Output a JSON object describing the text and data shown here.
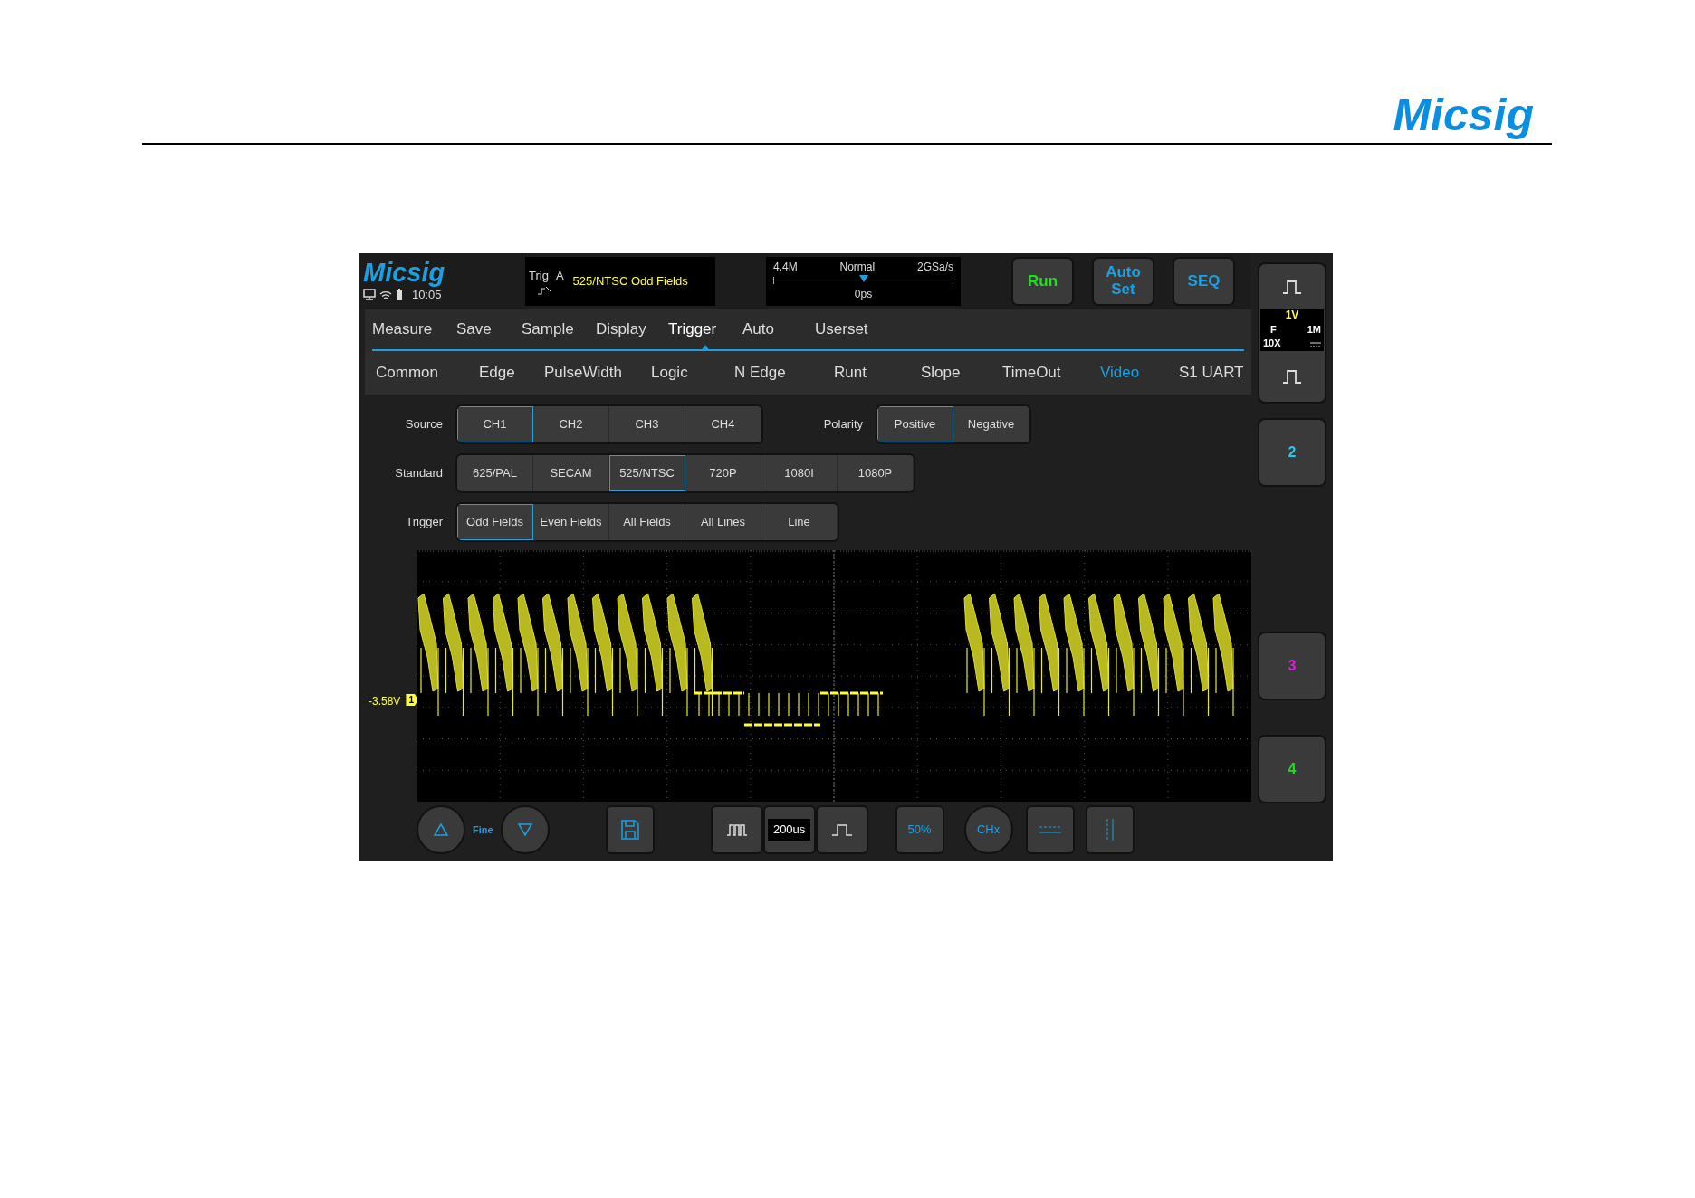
{
  "header": {
    "logo": "Micsig"
  },
  "screen": {
    "status": {
      "logo": "Micsig",
      "time": "10:05"
    },
    "trigger_info": {
      "label": "Trig",
      "source": "A",
      "description": "525/NTSC Odd Fields"
    },
    "acquisition": {
      "memory": "4.4M",
      "mode": "Normal",
      "sample_rate": "2GSa/s",
      "position": "0ps",
      "level": 0.5
    },
    "buttons": [
      {
        "label": "Run",
        "kind": "run"
      },
      {
        "label": "Auto Set",
        "kind": "mode"
      },
      {
        "label": "SEQ",
        "kind": "mode"
      }
    ],
    "menu_tabs": [
      {
        "label": "Measure",
        "selected": false
      },
      {
        "label": "Save",
        "selected": false
      },
      {
        "label": "Sample",
        "selected": false
      },
      {
        "label": "Display",
        "selected": false
      },
      {
        "label": "Trigger",
        "selected": true
      },
      {
        "label": "Auto",
        "selected": false
      },
      {
        "label": "Userset",
        "selected": false
      }
    ],
    "trigger_types": [
      {
        "label": "Common",
        "selected": false
      },
      {
        "label": "Edge",
        "selected": false
      },
      {
        "label": "PulseWidth",
        "selected": false
      },
      {
        "label": "Logic",
        "selected": false
      },
      {
        "label": "N Edge",
        "selected": false
      },
      {
        "label": "Runt",
        "selected": false
      },
      {
        "label": "Slope",
        "selected": false
      },
      {
        "label": "TimeOut",
        "selected": false
      },
      {
        "label": "Video",
        "selected": true
      },
      {
        "label": "S1 UART",
        "selected": false
      }
    ],
    "settings": [
      {
        "label": "Source",
        "options": [
          {
            "label": "CH1",
            "selected": true
          },
          {
            "label": "CH2",
            "selected": false
          },
          {
            "label": "CH3",
            "selected": false
          },
          {
            "label": "CH4",
            "selected": false
          }
        ]
      },
      {
        "label": "Standard",
        "options": [
          {
            "label": "625/PAL",
            "selected": false
          },
          {
            "label": "SECAM",
            "selected": false
          },
          {
            "label": "525/NTSC",
            "selected": true
          },
          {
            "label": "720P",
            "selected": false
          },
          {
            "label": "1080I",
            "selected": false
          },
          {
            "label": "1080P",
            "selected": false
          }
        ]
      },
      {
        "label": "Trigger",
        "options": [
          {
            "label": "Odd Fields",
            "selected": true
          },
          {
            "label": "Even Fields",
            "selected": false
          },
          {
            "label": "All Fields",
            "selected": false
          },
          {
            "label": "All Lines",
            "selected": false
          },
          {
            "label": "Line",
            "selected": false
          }
        ]
      }
    ],
    "polarity": {
      "label": "Polarity",
      "options": [
        {
          "label": "Positive",
          "selected": true
        },
        {
          "label": "Negative",
          "selected": false
        }
      ]
    },
    "channel1": {
      "scale": "1V",
      "coupling": "F",
      "probe": "10X",
      "impedance": "1M"
    },
    "channel_buttons": [
      {
        "label": "2",
        "color": "#22ccee"
      },
      {
        "label": "3",
        "color": "#dd22dd"
      },
      {
        "label": "4",
        "color": "#22dd22"
      }
    ],
    "scope": {
      "offset": "-3.58V",
      "marker": "1"
    },
    "toolbar": {
      "fine": "Fine",
      "timebase": "200us",
      "fifty": "50%",
      "channel": "CHx"
    }
  }
}
